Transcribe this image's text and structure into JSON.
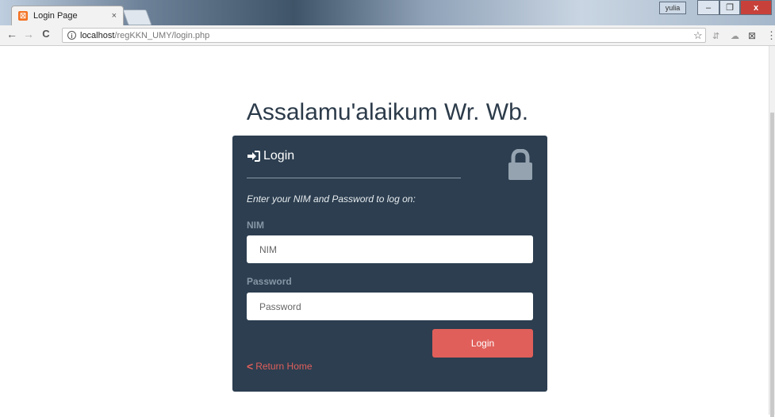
{
  "browser": {
    "tab_title": "Login Page",
    "tab_close": "×",
    "favicon_glyph": "☒",
    "url_host": "localhost",
    "url_path": "/regKKN_UMY/login.php",
    "user_label": "yulia",
    "back_glyph": "←",
    "forward_glyph": "→",
    "reload_glyph": "C",
    "info_glyph": "i",
    "star_glyph": "☆",
    "menu_glyph": "⋮",
    "minimize_glyph": "–",
    "maximize_glyph": "❐",
    "close_glyph": "x"
  },
  "page": {
    "greeting": "Assalamu'alaikum Wr. Wb."
  },
  "login_card": {
    "title": "Login",
    "subtitle": "Enter your NIM and Password to log on:",
    "nim_label": "NIM",
    "nim_placeholder": "NIM",
    "password_label": "Password",
    "password_placeholder": "Password",
    "login_button": "Login",
    "return_home": "Return Home",
    "return_chevron": "<"
  },
  "colors": {
    "card_bg": "#2c3e50",
    "accent": "#e05f5a",
    "label": "#8797a6"
  },
  "icons": [
    "sign-in-icon",
    "lock-icon",
    "chevron-left-icon"
  ]
}
